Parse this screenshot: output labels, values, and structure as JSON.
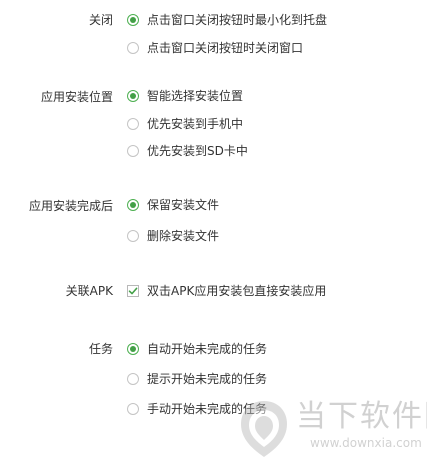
{
  "sections": {
    "close": {
      "label": "关闭",
      "options": [
        {
          "label": "点击窗口关闭按钮时最小化到托盘",
          "checked": true
        },
        {
          "label": "点击窗口关闭按钮时关闭窗口",
          "checked": false
        }
      ]
    },
    "install_location": {
      "label": "应用安装位置",
      "options": [
        {
          "label": "智能选择安装位置",
          "checked": true
        },
        {
          "label": "优先安装到手机中",
          "checked": false
        },
        {
          "label": "优先安装到SD卡中",
          "checked": false
        }
      ]
    },
    "after_install": {
      "label": "应用安装完成后",
      "options": [
        {
          "label": "保留安装文件",
          "checked": true
        },
        {
          "label": "删除安装文件",
          "checked": false
        }
      ]
    },
    "apk_assoc": {
      "label": "关联APK",
      "checkbox": {
        "label": "双击APK应用安装包直接安装应用",
        "checked": true
      }
    },
    "tasks": {
      "label": "任务",
      "options": [
        {
          "label": "自动开始未完成的任务",
          "checked": true
        },
        {
          "label": "提示开始未完成的任务",
          "checked": false
        },
        {
          "label": "手动开始未完成的任务",
          "checked": false
        }
      ]
    }
  },
  "watermark": {
    "brand": "当下软件园",
    "url": "www.downxia.com"
  },
  "colors": {
    "accent": "#43a047",
    "text": "#333333",
    "radio_border": "#c4c4c4",
    "watermark": "#9a9a9a"
  }
}
